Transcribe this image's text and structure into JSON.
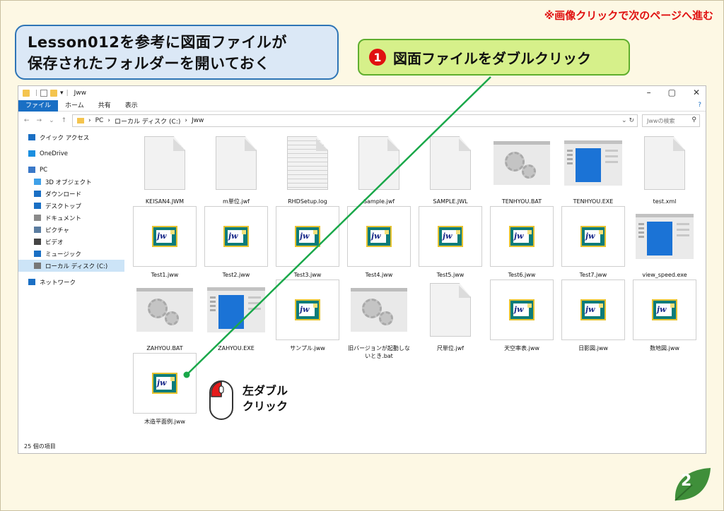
{
  "top_note": "※画像クリックで次のページへ進む",
  "callout_blue": {
    "line1": "Lesson012を参考に図面ファイルが",
    "line2": "保存されたフォルダーを開いておく"
  },
  "callout_green": {
    "step": "1",
    "text": "図面ファイルをダブルクリック"
  },
  "explorer": {
    "title": "Jww",
    "window_controls": [
      "–",
      "▢",
      "✕"
    ],
    "ribbon_tabs": [
      "ファイル",
      "ホーム",
      "共有",
      "表示"
    ],
    "address_segments": [
      "PC",
      "›",
      "ローカル ディスク (C:)",
      "›",
      "Jww"
    ],
    "search_placeholder": "Jwwの検索",
    "nav_items": [
      {
        "label": "クイック アクセス",
        "icon": "star-icon"
      },
      {
        "label": "OneDrive",
        "icon": "cloud-icon"
      },
      {
        "label": "PC",
        "icon": "pc-icon"
      },
      {
        "label": "3D オブジェクト",
        "icon": "cube-icon"
      },
      {
        "label": "ダウンロード",
        "icon": "download-icon"
      },
      {
        "label": "デスクトップ",
        "icon": "desktop-icon"
      },
      {
        "label": "ドキュメント",
        "icon": "document-icon"
      },
      {
        "label": "ピクチャ",
        "icon": "picture-icon"
      },
      {
        "label": "ビデオ",
        "icon": "video-icon"
      },
      {
        "label": "ミュージック",
        "icon": "music-icon"
      },
      {
        "label": "ローカル ディスク (C:)",
        "icon": "disk-icon"
      },
      {
        "label": "ネットワーク",
        "icon": "network-icon"
      }
    ],
    "files": [
      {
        "name": "KEISAN4.JWM",
        "kind": "doc"
      },
      {
        "name": "m単位.jwf",
        "kind": "doc"
      },
      {
        "name": "RHDSetup.log",
        "kind": "log"
      },
      {
        "name": "Sample.jwf",
        "kind": "doc"
      },
      {
        "name": "SAMPLE.JWL",
        "kind": "doc"
      },
      {
        "name": "TENHYOU.BAT",
        "kind": "bat"
      },
      {
        "name": "TENHYOU.EXE",
        "kind": "exe"
      },
      {
        "name": "test.xml",
        "kind": "doc"
      },
      {
        "name": "Test1.jww",
        "kind": "jww"
      },
      {
        "name": "Test2.jww",
        "kind": "jww"
      },
      {
        "name": "Test3.jww",
        "kind": "jww"
      },
      {
        "name": "Test4.jww",
        "kind": "jww"
      },
      {
        "name": "Test5.jww",
        "kind": "jww"
      },
      {
        "name": "Test6.jww",
        "kind": "jww"
      },
      {
        "name": "Test7.jww",
        "kind": "jww"
      },
      {
        "name": "view_speed.exe",
        "kind": "exe"
      },
      {
        "name": "ZAHYOU.BAT",
        "kind": "bat"
      },
      {
        "name": "ZAHYOU.EXE",
        "kind": "exe"
      },
      {
        "name": "サンプル.jww",
        "kind": "jww"
      },
      {
        "name": "旧バージョンが起動しないとき.bat",
        "kind": "bat"
      },
      {
        "name": "尺単位.jwf",
        "kind": "doc"
      },
      {
        "name": "天空率表.jww",
        "kind": "jww"
      },
      {
        "name": "日影図.jww",
        "kind": "jww"
      },
      {
        "name": "数地図.jww",
        "kind": "jww"
      },
      {
        "name": "木造平面例.jww",
        "kind": "jww"
      }
    ],
    "status": "25 個の項目"
  },
  "mouse_label": {
    "line1": "左ダブル",
    "line2": "クリック"
  },
  "page_number": "2",
  "colors": {
    "accent_red": "#e01010",
    "callout_blue_border": "#2e75b6",
    "callout_green_fill": "#d6f08a",
    "pointer_line": "#1aa84a",
    "badge_green": "#3f8f3a"
  }
}
